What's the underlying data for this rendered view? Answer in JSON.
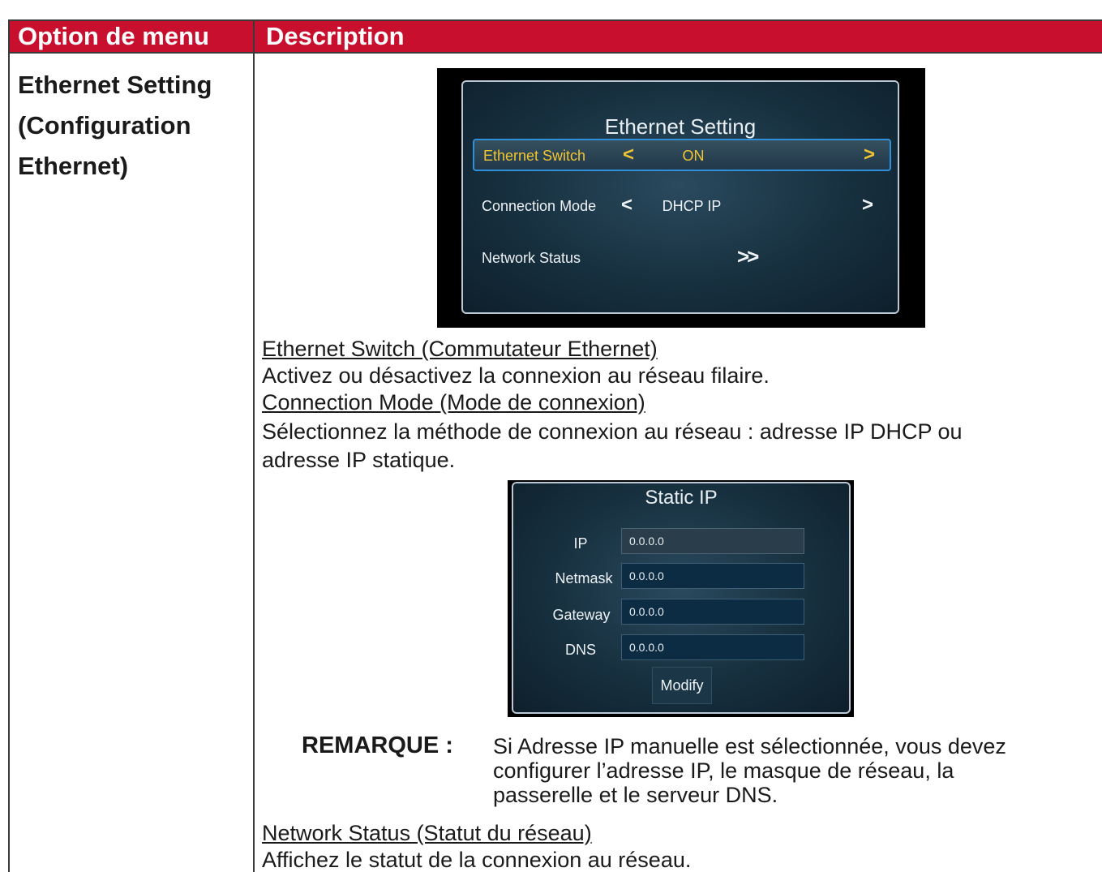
{
  "table_header": {
    "col1": "Option de menu",
    "col2": "Description"
  },
  "menu_option": {
    "line1": "Ethernet Setting",
    "line2": "(Configuration",
    "line3": "Ethernet)"
  },
  "osd_ethernet": {
    "title": "Ethernet Setting",
    "rows": [
      {
        "label": "Ethernet Switch",
        "value": "ON",
        "selected": true
      },
      {
        "label": "Connection Mode",
        "value": "DHCP IP",
        "selected": false
      },
      {
        "label": "Network Status",
        "value": ">>",
        "selected": false
      }
    ],
    "arrow_left": "<",
    "arrow_right": ">"
  },
  "desc": {
    "ethernet_switch_heading": "Ethernet Switch (Commutateur Ethernet)",
    "ethernet_switch_text": "Activez ou désactivez la connexion au réseau filaire.",
    "connection_mode_heading": "Connection Mode (Mode de connexion)",
    "connection_mode_text_1": "Sélectionnez la méthode de connexion au réseau : adresse IP DHCP ou",
    "connection_mode_text_2": "adresse IP statique.",
    "network_status_heading": "Network Status (Statut du réseau)",
    "network_status_text": "Affichez le statut de la connexion au réseau."
  },
  "osd_static_ip": {
    "title": "Static IP",
    "fields": [
      {
        "label": "IP",
        "value": "0.0.0.0"
      },
      {
        "label": "Netmask",
        "value": "0.0.0.0"
      },
      {
        "label": "Gateway",
        "value": "0.0.0.0"
      },
      {
        "label": "DNS",
        "value": "0.0.0.0"
      }
    ],
    "modify_label": "Modify"
  },
  "note": {
    "label": "REMARQUE :",
    "line1": "Si Adresse IP manuelle est sélectionnée, vous devez",
    "line2": "configurer l’adresse IP, le masque de réseau, la",
    "line3": "passerelle et le serveur DNS."
  },
  "colors": {
    "header_bg": "#c8102e",
    "selected_text": "#f2c531",
    "highlight_border": "#2f8fd8"
  }
}
